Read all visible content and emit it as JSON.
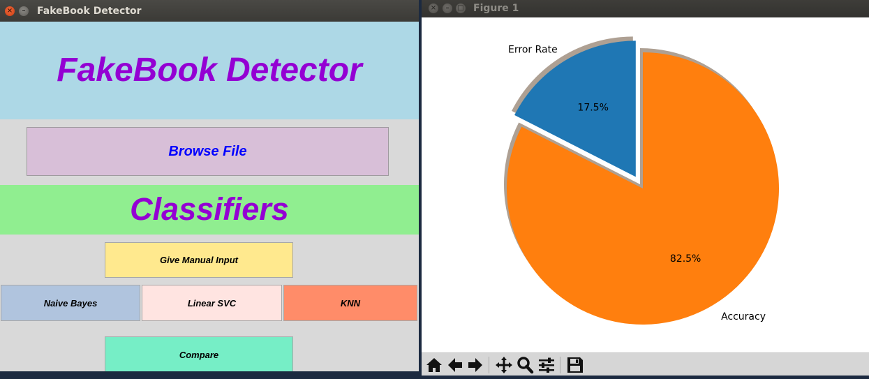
{
  "left_window": {
    "title": "FakeBook Detector",
    "banner_title": "FakeBook Detector",
    "browse_label": "Browse File",
    "section_title": "Classifiers",
    "buttons": {
      "manual": "Give Manual Input",
      "naive_bayes": "Naive Bayes",
      "linear_svc": "Linear SVC",
      "knn": "KNN",
      "compare": "Compare"
    },
    "colors": {
      "banner_bg": "#add8e6",
      "title_text": "#9400d3",
      "browse_bg": "#d8bfd8",
      "browse_text": "#0000ff",
      "section_bg": "#90ee90",
      "manual_bg": "#ffe98e",
      "naive_bayes_bg": "#b0c4de",
      "linear_svc_bg": "#ffe4e1",
      "knn_bg": "#ff8c69",
      "compare_bg": "#76eec6"
    }
  },
  "right_window": {
    "title": "Figure 1",
    "toolbar": [
      {
        "name": "home-icon"
      },
      {
        "name": "back-arrow-icon"
      },
      {
        "name": "forward-arrow-icon"
      },
      {
        "name": "pan-icon"
      },
      {
        "name": "zoom-icon"
      },
      {
        "name": "configure-subplots-icon"
      },
      {
        "name": "save-icon"
      }
    ]
  },
  "chart_data": {
    "type": "pie",
    "labels": [
      "Error Rate",
      "Accuracy"
    ],
    "values": [
      17.5,
      82.5
    ],
    "percent_labels": [
      "17.5%",
      "82.5%"
    ],
    "colors": [
      "#1f77b4",
      "#ff7f0e"
    ],
    "explode": [
      0.1,
      0
    ],
    "shadow": true,
    "start_angle_deg": 90,
    "title": ""
  }
}
